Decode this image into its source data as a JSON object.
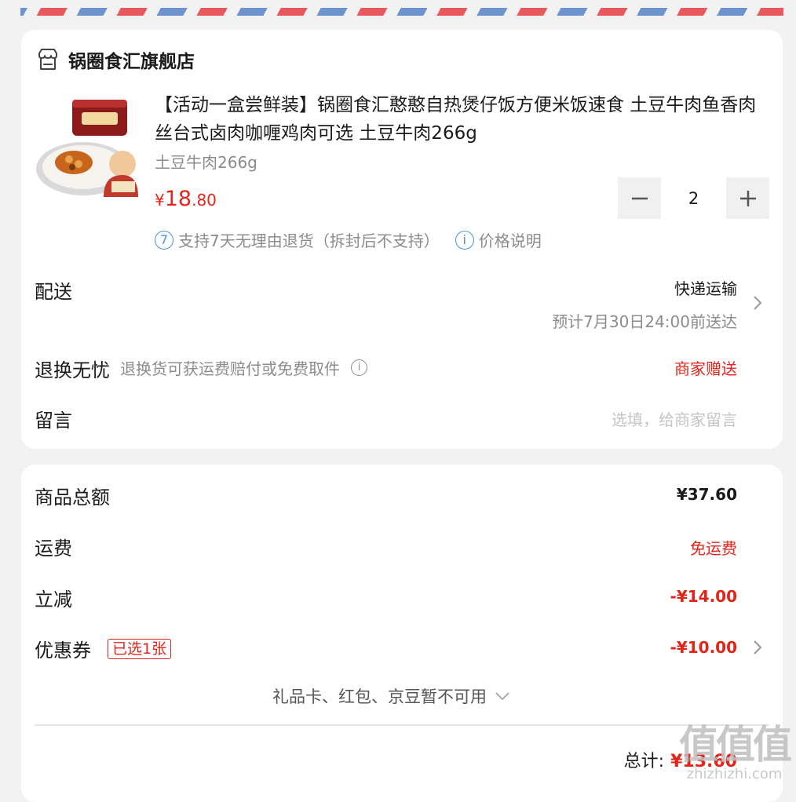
{
  "store": {
    "name": "锅圈食汇旗舰店",
    "icon": "store-icon"
  },
  "product": {
    "title": "【活动一盒尝鲜装】锅圈食汇憨憨自热煲仔饭方便米饭速食 土豆牛肉鱼香肉丝台式卤肉咖喱鸡肉可选 土豆牛肉266g",
    "spec": "土豆牛肉266g",
    "price_symbol": "¥",
    "price_int": "18",
    "price_dec": ".80",
    "quantity": "2",
    "service_badge": "7",
    "service_text": "支持7天无理由退货（拆封后不支持）",
    "price_note_icon": "i",
    "price_note": "价格说明"
  },
  "delivery": {
    "label": "配送",
    "method": "快递运输",
    "eta": "预计7月30日24:00前送达"
  },
  "return": {
    "label": "退换无忧",
    "hint": "退换货可获运费赔付或免费取件",
    "info_icon": "i",
    "value": "商家赠送"
  },
  "message": {
    "label": "留言",
    "placeholder": "选填，给商家留言"
  },
  "summary": {
    "goods_total_label": "商品总额",
    "goods_total": "¥37.60",
    "shipping_label": "运费",
    "shipping": "免运费",
    "discount_label": "立减",
    "discount": "-¥14.00",
    "coupon_label": "优惠券",
    "coupon_badge": "已选1张",
    "coupon": "-¥10.00",
    "unavailable": "礼品卡、红包、京豆暂不可用",
    "total_label": "总计:",
    "total": "¥13.60"
  },
  "watermark": {
    "logo": "值值值",
    "url": "zhizhizhi.com"
  },
  "colors": {
    "accent": "#e1251b",
    "info_blue": "#4a90e2",
    "muted": "#8c8c8c"
  }
}
